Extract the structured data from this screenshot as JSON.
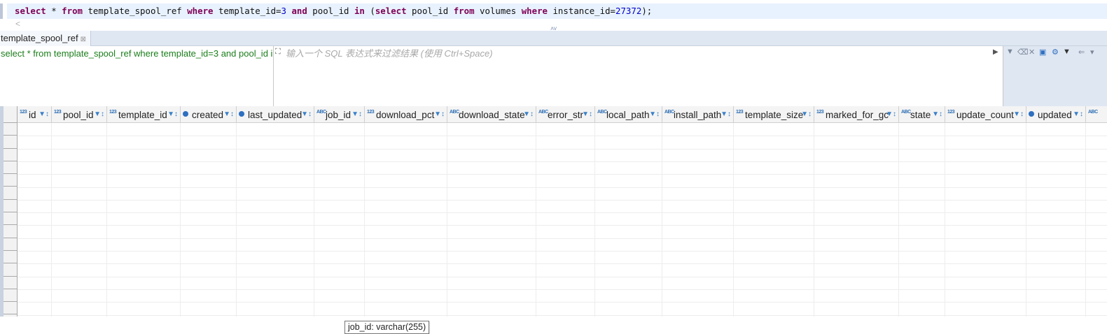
{
  "editor": {
    "sql": [
      {
        "t": "select",
        "k": "kw"
      },
      {
        "t": " * ",
        "k": ""
      },
      {
        "t": "from",
        "k": "kw"
      },
      {
        "t": " template_spool_ref ",
        "k": ""
      },
      {
        "t": "where",
        "k": "kw"
      },
      {
        "t": " template_id=",
        "k": ""
      },
      {
        "t": "3",
        "k": "num"
      },
      {
        "t": " ",
        "k": ""
      },
      {
        "t": "and",
        "k": "kw"
      },
      {
        "t": " pool_id ",
        "k": ""
      },
      {
        "t": "in",
        "k": "kw"
      },
      {
        "t": " (",
        "k": ""
      },
      {
        "t": "select",
        "k": "kw"
      },
      {
        "t": " pool_id ",
        "k": ""
      },
      {
        "t": "from",
        "k": "kw"
      },
      {
        "t": " volumes ",
        "k": ""
      },
      {
        "t": "where",
        "k": "kw"
      },
      {
        "t": " instance_id=",
        "k": ""
      },
      {
        "t": "27372",
        "k": "num"
      },
      {
        "t": ");",
        "k": ""
      }
    ],
    "scroll_left": "<",
    "splitter": "˄˅"
  },
  "results_tab": {
    "label": "template_spool_ref",
    "close": "⊠"
  },
  "filter": {
    "query_text": "select * from template_spool_ref where template_id=3 and pool_id i",
    "placeholder": "输入一个 SQL 表达式来过滤结果 (使用 Ctrl+Space)"
  },
  "columns": [
    {
      "name": "id",
      "type": "123",
      "w": 49
    },
    {
      "name": "pool_id",
      "type": "123",
      "w": 79
    },
    {
      "name": "template_id",
      "type": "123",
      "w": 105
    },
    {
      "name": "created",
      "type": "dt",
      "w": 80
    },
    {
      "name": "last_updated",
      "type": "dt",
      "w": 111
    },
    {
      "name": "job_id",
      "type": "ABC",
      "w": 72
    },
    {
      "name": "download_pct",
      "type": "123",
      "w": 118
    },
    {
      "name": "download_state",
      "type": "ABC",
      "w": 127
    },
    {
      "name": "error_str",
      "type": "ABC",
      "w": 84
    },
    {
      "name": "local_path",
      "type": "ABC",
      "w": 96
    },
    {
      "name": "install_path",
      "type": "ABC",
      "w": 102
    },
    {
      "name": "template_size",
      "type": "123",
      "w": 115
    },
    {
      "name": "marked_for_gc",
      "type": "123",
      "w": 121
    },
    {
      "name": "state",
      "type": "ABC",
      "w": 66
    },
    {
      "name": "update_count",
      "type": "123",
      "w": 116
    },
    {
      "name": "updated",
      "type": "dt",
      "w": 85
    },
    {
      "name": "",
      "type": "ABC",
      "w": 31
    }
  ],
  "tooltip": "job_id: varchar(255)",
  "colors": {
    "accent": "#2e6fc0",
    "keyword": "#7f0055",
    "number": "#0000c8",
    "filter_text": "#1b7d1b"
  }
}
